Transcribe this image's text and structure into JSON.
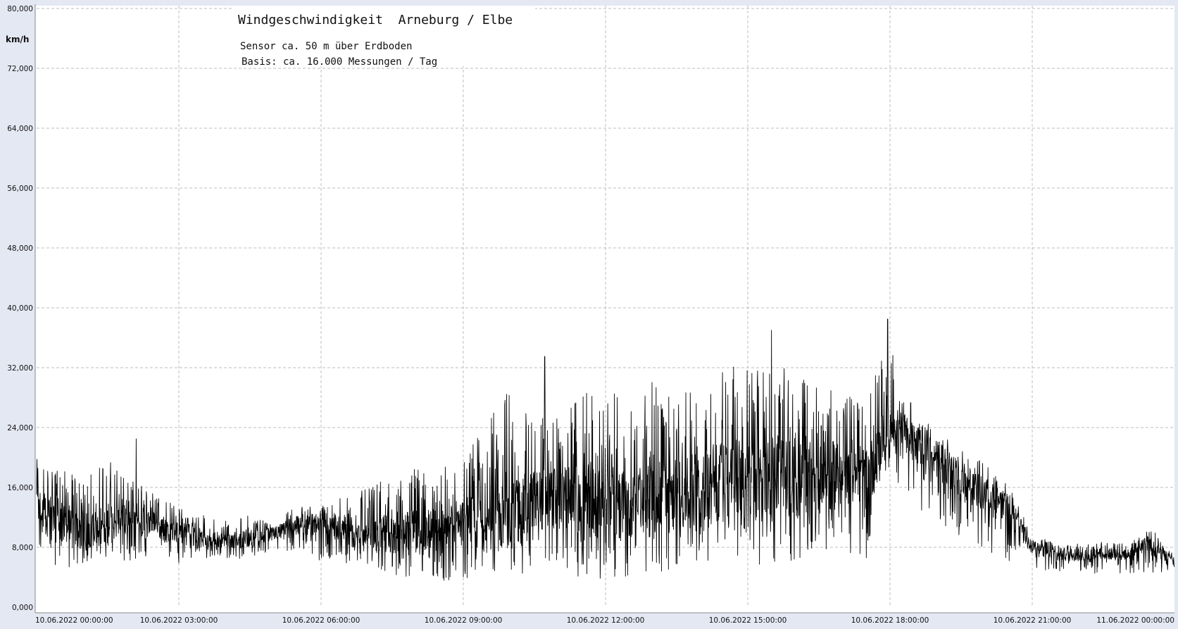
{
  "chart_data": {
    "type": "line",
    "title": "Windgeschwindigkeit  Arneburg / Elbe",
    "subtitle_lines": [
      "Sensor ca. 50 m über Erdboden",
      "Basis: ca. 16.000 Messungen / Tag"
    ],
    "ylabel": "km/h",
    "xlabel": "",
    "ylim": [
      0,
      80
    ],
    "y_ticks": [
      "0,000",
      "8,000",
      "16,000",
      "24,000",
      "32,000",
      "40,000",
      "48,000",
      "56,000",
      "64,000",
      "72,000",
      "80,000"
    ],
    "x_range_hours": [
      0,
      24
    ],
    "x_tick_labels": [
      "10.06.2022  00:00:00",
      "10.06.2022  03:00:00",
      "10.06.2022  06:00:00",
      "10.06.2022  09:00:00",
      "10.06.2022  12:00:00",
      "10.06.2022  15:00:00",
      "10.06.2022  18:00:00",
      "10.06.2022  21:00:00",
      "11.06.2022  00:00:00"
    ],
    "grid": true,
    "line_color": "#000000",
    "series": [
      {
        "name": "",
        "envelope_hourly": {
          "hours": [
            0,
            0.5,
            1,
            1.5,
            2,
            2.5,
            3,
            3.5,
            4,
            4.5,
            5,
            5.5,
            6,
            6.5,
            7,
            7.5,
            8,
            8.5,
            9,
            9.5,
            10,
            10.5,
            11,
            11.5,
            12,
            12.5,
            13,
            13.5,
            14,
            14.5,
            15,
            15.5,
            16,
            16.5,
            17,
            17.5,
            18,
            18.5,
            19,
            19.5,
            20,
            20.5,
            21,
            21.5,
            22,
            22.5,
            23,
            23.5,
            24
          ],
          "mean": [
            13,
            11,
            10,
            11,
            12,
            11,
            10,
            9,
            9,
            9,
            10,
            11,
            11,
            10,
            9,
            10,
            10,
            11,
            11,
            11,
            12,
            14,
            15,
            14,
            14,
            13,
            15,
            15,
            16,
            17,
            17,
            18,
            17,
            17,
            18,
            17,
            24,
            22,
            20,
            17,
            15,
            13,
            8,
            7,
            7,
            7,
            7,
            9,
            6
          ],
          "max": [
            21,
            20,
            18,
            22,
            18,
            16,
            14,
            13,
            12,
            13,
            12,
            14,
            14,
            16,
            17,
            19,
            20,
            21,
            22,
            27,
            33,
            28,
            27,
            31,
            32,
            31,
            33,
            31,
            31,
            37,
            35,
            35,
            34,
            32,
            30,
            30,
            38,
            27,
            24,
            22,
            20,
            17,
            10,
            9,
            9,
            9,
            9,
            11,
            7
          ],
          "min": [
            7,
            4,
            4,
            6,
            5,
            5,
            5,
            6,
            6,
            6,
            7,
            7,
            5,
            5,
            5,
            3,
            3,
            2,
            2,
            3,
            3,
            3,
            4,
            2,
            2,
            2,
            2,
            3,
            4,
            5,
            4,
            3,
            4,
            4,
            4,
            4,
            17,
            12,
            10,
            8,
            6,
            5,
            5,
            4,
            4,
            4,
            4,
            4,
            3
          ]
        },
        "notable_points": [
          {
            "time": "10.06.2022 02:06",
            "value": 22.5
          },
          {
            "time": "10.06.2022 10:43",
            "value": 33.5
          },
          {
            "time": "10.06.2022 15:30",
            "value": 37.0
          },
          {
            "time": "10.06.2022 17:57",
            "value": 38.5
          }
        ]
      }
    ]
  }
}
